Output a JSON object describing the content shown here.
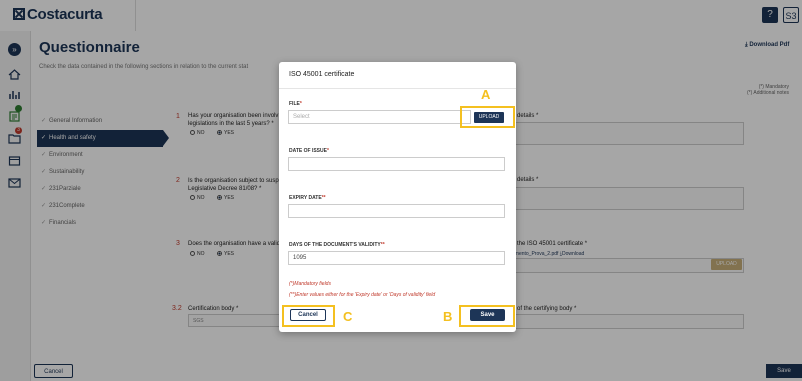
{
  "header": {
    "logo": "Costacurta",
    "help_label": "?",
    "user_initials": "S3"
  },
  "rail": {
    "expand_icon": "chevron-right-icon",
    "badges": [
      "",
      "3"
    ]
  },
  "page": {
    "title": "Questionnaire",
    "subtitle": "Check the data contained in the following sections in relation to the current stat",
    "download_label": "Download Pdf",
    "legend_mandatory": "(*) Mandatory",
    "legend_additional": "(*) Additional notes"
  },
  "nav": {
    "items": [
      {
        "label": "General Information"
      },
      {
        "label": "Health and safety"
      },
      {
        "label": "Environment"
      },
      {
        "label": "Sustainability"
      },
      {
        "label": "231Parziale"
      },
      {
        "label": "231Complete"
      },
      {
        "label": "Financials"
      }
    ]
  },
  "questions": [
    {
      "num": "1",
      "text": "Has your organisation been involv",
      "text2": "legislations in the last 5 years? *",
      "right": "e details *"
    },
    {
      "num": "2",
      "text": "Is the organisation subject to susp",
      "text2": "Legislative Decree 81/08? *",
      "right": "e details *"
    },
    {
      "num": "3",
      "text": "Does the organisation have a valid",
      "text2": "",
      "right": "h the ISO 45001 certificate *",
      "file": "umento_Prova_2.pdf",
      "download": "Download",
      "upload": "UPLOAD"
    },
    {
      "num": "3.2",
      "text": "Certification body *",
      "text2": "",
      "right": "e of the certifying body *",
      "value": "SGS"
    }
  ],
  "radio": {
    "no": "NO",
    "yes": "YES"
  },
  "footer": {
    "cancel": "Cancel",
    "save": "Save"
  },
  "modal": {
    "title": "ISO 45001 certificate",
    "file_label": "FILE",
    "file_placeholder": "Select",
    "upload_label": "UPLOAD",
    "date_issue_label": "DATE OF ISSUE",
    "expiry_label": "EXPIRY DATE",
    "validity_label": "DAYS OF THE DOCUMENT'S VALIDITY",
    "validity_value": "1095",
    "note1": "(*)Mandatory fields",
    "note2": "(**)Enter values either for the 'Expiry date' or 'Days of validity' field",
    "cancel_label": "Cancel",
    "save_label": "Save"
  },
  "annotations": {
    "a": "A",
    "b": "B",
    "c": "C",
    "color": "#f4c020"
  }
}
